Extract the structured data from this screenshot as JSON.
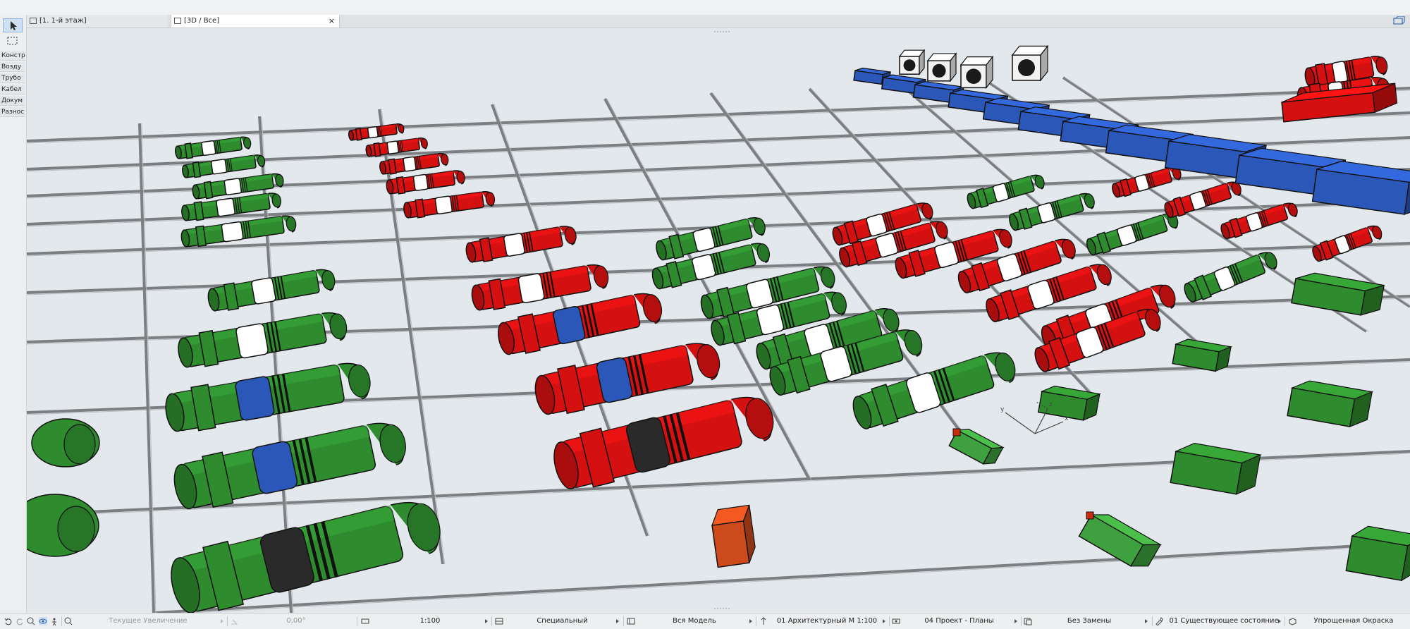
{
  "tabs": [
    {
      "label": "[1. 1-й этаж]",
      "icon": "floor-plan-icon"
    },
    {
      "label": "[3D / Все]",
      "icon": "3d-window-icon",
      "close": "×"
    }
  ],
  "toolbox": {
    "tools": [
      "arrow-select-icon",
      "marquee-icon"
    ],
    "palette": [
      "Констр",
      "Возду",
      "Трубо",
      "Кабел",
      "Докум",
      "Разнос"
    ]
  },
  "status": {
    "zoom_label": "Текущее Увеличение",
    "angle": "0,00°",
    "scale": "1:100",
    "structure": "Специальный",
    "model_view": "Вся Модель",
    "layer_combo": "01 Архитектурный М 1:100",
    "pen_set": "04 Проект - Планы",
    "override": "Без Замены",
    "renovation": "01 Существующее состояние",
    "shading": "Упрощенная Окраска"
  },
  "axis_labels": {
    "x": "x",
    "y": "y",
    "z": "z"
  },
  "colors": {
    "duct_green": "#2e8b2e",
    "duct_red": "#d51010",
    "duct_blue": "#2b57b8",
    "floor": "#e3e8ec",
    "grid": "#7c7f82"
  }
}
